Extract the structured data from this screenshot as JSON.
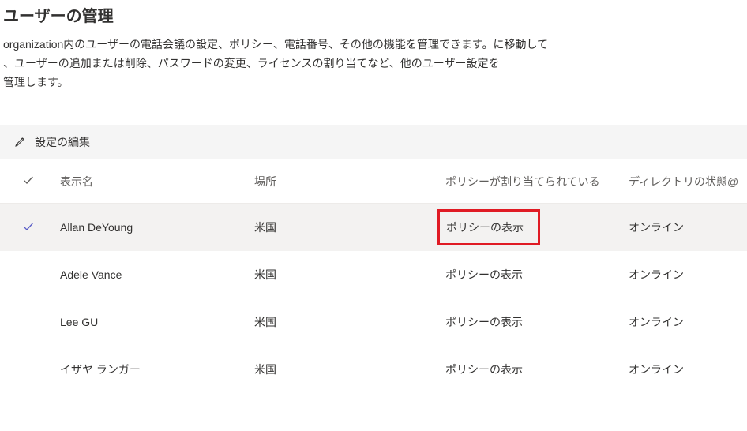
{
  "page": {
    "title": "ユーザーの管理",
    "description_line1": "organization内のユーザーの電話会議の設定、ポリシー、電話番号、その他の機能を管理できます。に移動して",
    "description_line2": "、ユーザーの追加または削除、パスワードの変更、ライセンスの割り当てなど、他のユーザー設定を",
    "description_line3": "管理します。"
  },
  "toolbar": {
    "edit_label": "設定の編集"
  },
  "columns": {
    "display_name": "表示名",
    "location": "場所",
    "policy_assigned": "ポリシーが割り当てられている",
    "directory_status": "ディレクトリの状態@"
  },
  "rows": [
    {
      "selected": true,
      "name": "Allan DeYoung",
      "location": "米国",
      "policy_link": "ポリシーの表示",
      "directory": "オンライン",
      "highlighted": true
    },
    {
      "selected": false,
      "name": "Adele Vance",
      "location": "米国",
      "policy_link": "ポリシーの表示",
      "directory": "オンライン",
      "highlighted": false
    },
    {
      "selected": false,
      "name": "Lee GU",
      "location": "米国",
      "policy_link": "ポリシーの表示",
      "directory": "オンライン",
      "highlighted": false
    },
    {
      "selected": false,
      "name": "イザヤ ランガー",
      "location": "米国",
      "policy_link": "ポリシーの表示",
      "directory": "オンライン",
      "highlighted": false
    }
  ]
}
